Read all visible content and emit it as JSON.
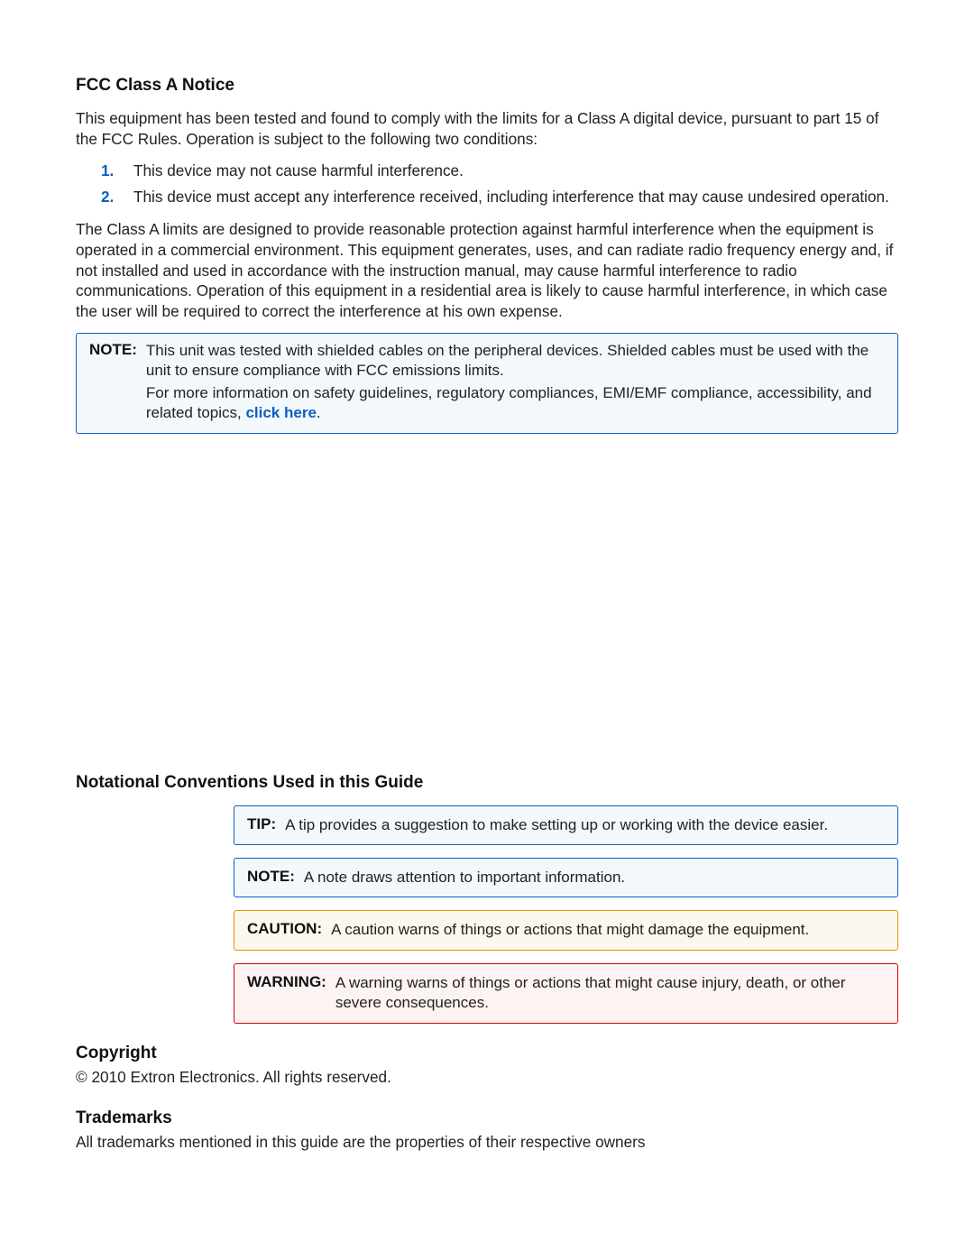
{
  "fcc": {
    "title": "FCC Class A Notice",
    "intro": "This equipment has been tested and found to comply with the limits for a Class A digital device, pursuant to part 15 of the FCC Rules. Operation is subject to the following two conditions:",
    "list": {
      "m1": "1.",
      "t1": "This device may not cause harmful interference.",
      "m2": "2.",
      "t2": "This device must accept any interference received, including interference that may cause undesired operation."
    },
    "para2": "The Class A limits are designed to provide reasonable protection against harmful interference when the equipment is operated in a commercial environment. This equipment generates, uses, and can radiate radio frequency energy and, if not installed and used in accordance with the instruction manual, may cause harmful interference to radio communications. Operation of this equipment in a residential area is likely to cause harmful interference, in which case the user will be required to correct the interference at his own expense.",
    "note": {
      "label": "NOTE:",
      "line1": "This unit was tested with shielded cables on the peripheral devices. Shielded cables must be used with the unit to ensure compliance with FCC emissions limits.",
      "line2_a": "For more information on safety guidelines, regulatory compliances, EMI/EMF compliance, accessibility, and related topics, ",
      "link": "click here",
      "line2_b": "."
    }
  },
  "conventions": {
    "title": "Notational Conventions Used in this Guide",
    "tip": {
      "label": "TIP:",
      "text": "A tip provides a suggestion to make setting up or working with the device easier."
    },
    "note": {
      "label": "NOTE:",
      "text": "A note draws attention to important information."
    },
    "caution": {
      "label": "CAUTION:",
      "text": "A caution warns of things or actions that might damage the equipment."
    },
    "warning": {
      "label": "WARNING:",
      "text": "A warning warns of things or actions that might cause injury, death, or other severe consequences."
    }
  },
  "copyright": {
    "title": "Copyright",
    "text": "© 2010 Extron Electronics. All rights reserved."
  },
  "trademarks": {
    "title": "Trademarks",
    "text": "All trademarks mentioned in this guide are the properties of their respective owners"
  }
}
